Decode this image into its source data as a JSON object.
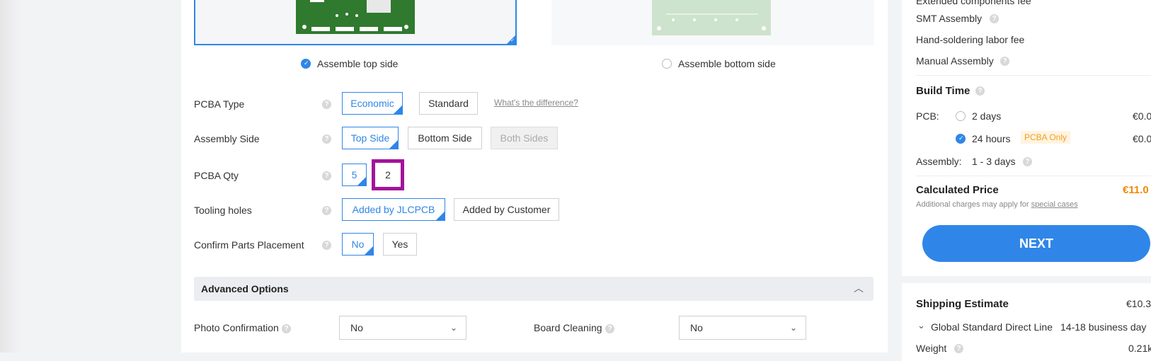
{
  "sides": {
    "top_label": "Assemble top side",
    "bottom_label": "Assemble bottom side"
  },
  "form": {
    "pcba_type": {
      "label": "PCBA Type",
      "options": [
        "Economic",
        "Standard"
      ],
      "link": "What's the difference?"
    },
    "assembly_side": {
      "label": "Assembly Side",
      "options": [
        "Top Side",
        "Bottom Side",
        "Both Sides"
      ]
    },
    "pcba_qty": {
      "label": "PCBA Qty",
      "options": [
        "5",
        "2"
      ]
    },
    "tooling_holes": {
      "label": "Tooling holes",
      "options": [
        "Added by JLCPCB",
        "Added by Customer"
      ]
    },
    "confirm_parts": {
      "label": "Confirm Parts Placement",
      "options": [
        "No",
        "Yes"
      ]
    }
  },
  "advanced": {
    "title": "Advanced Options",
    "photo": {
      "label": "Photo Confirmation",
      "value": "No"
    },
    "cleaning": {
      "label": "Board Cleaning",
      "value": "No"
    }
  },
  "summary": {
    "fees_header": "Extended components fee",
    "smt": "SMT Assembly",
    "hand_solder": "Hand-soldering labor fee",
    "manual": "Manual Assembly",
    "build_time": "Build Time",
    "pcb_label": "PCB:",
    "opt_2days": "2 days",
    "opt_2days_price": "€0.0",
    "opt_24h": "24 hours",
    "opt_24h_price": "€0.0",
    "pcba_only": "PCBA Only",
    "assembly_label": "Assembly:",
    "assembly_time": "1 - 3 days",
    "calc_label": "Calculated Price",
    "calc_value": "€11.0",
    "note_prefix": "Additional charges may apply for ",
    "note_link": "special cases",
    "next": "NEXT"
  },
  "shipping": {
    "title": "Shipping Estimate",
    "price": "€10.3",
    "method": "Global Standard Direct Line",
    "days": "14-18 business day",
    "weight_label": "Weight",
    "weight": "0.21k"
  },
  "colors": {
    "accent": "#2f86e8",
    "price_orange": "#f08a00",
    "highlight": "#a3139a"
  }
}
